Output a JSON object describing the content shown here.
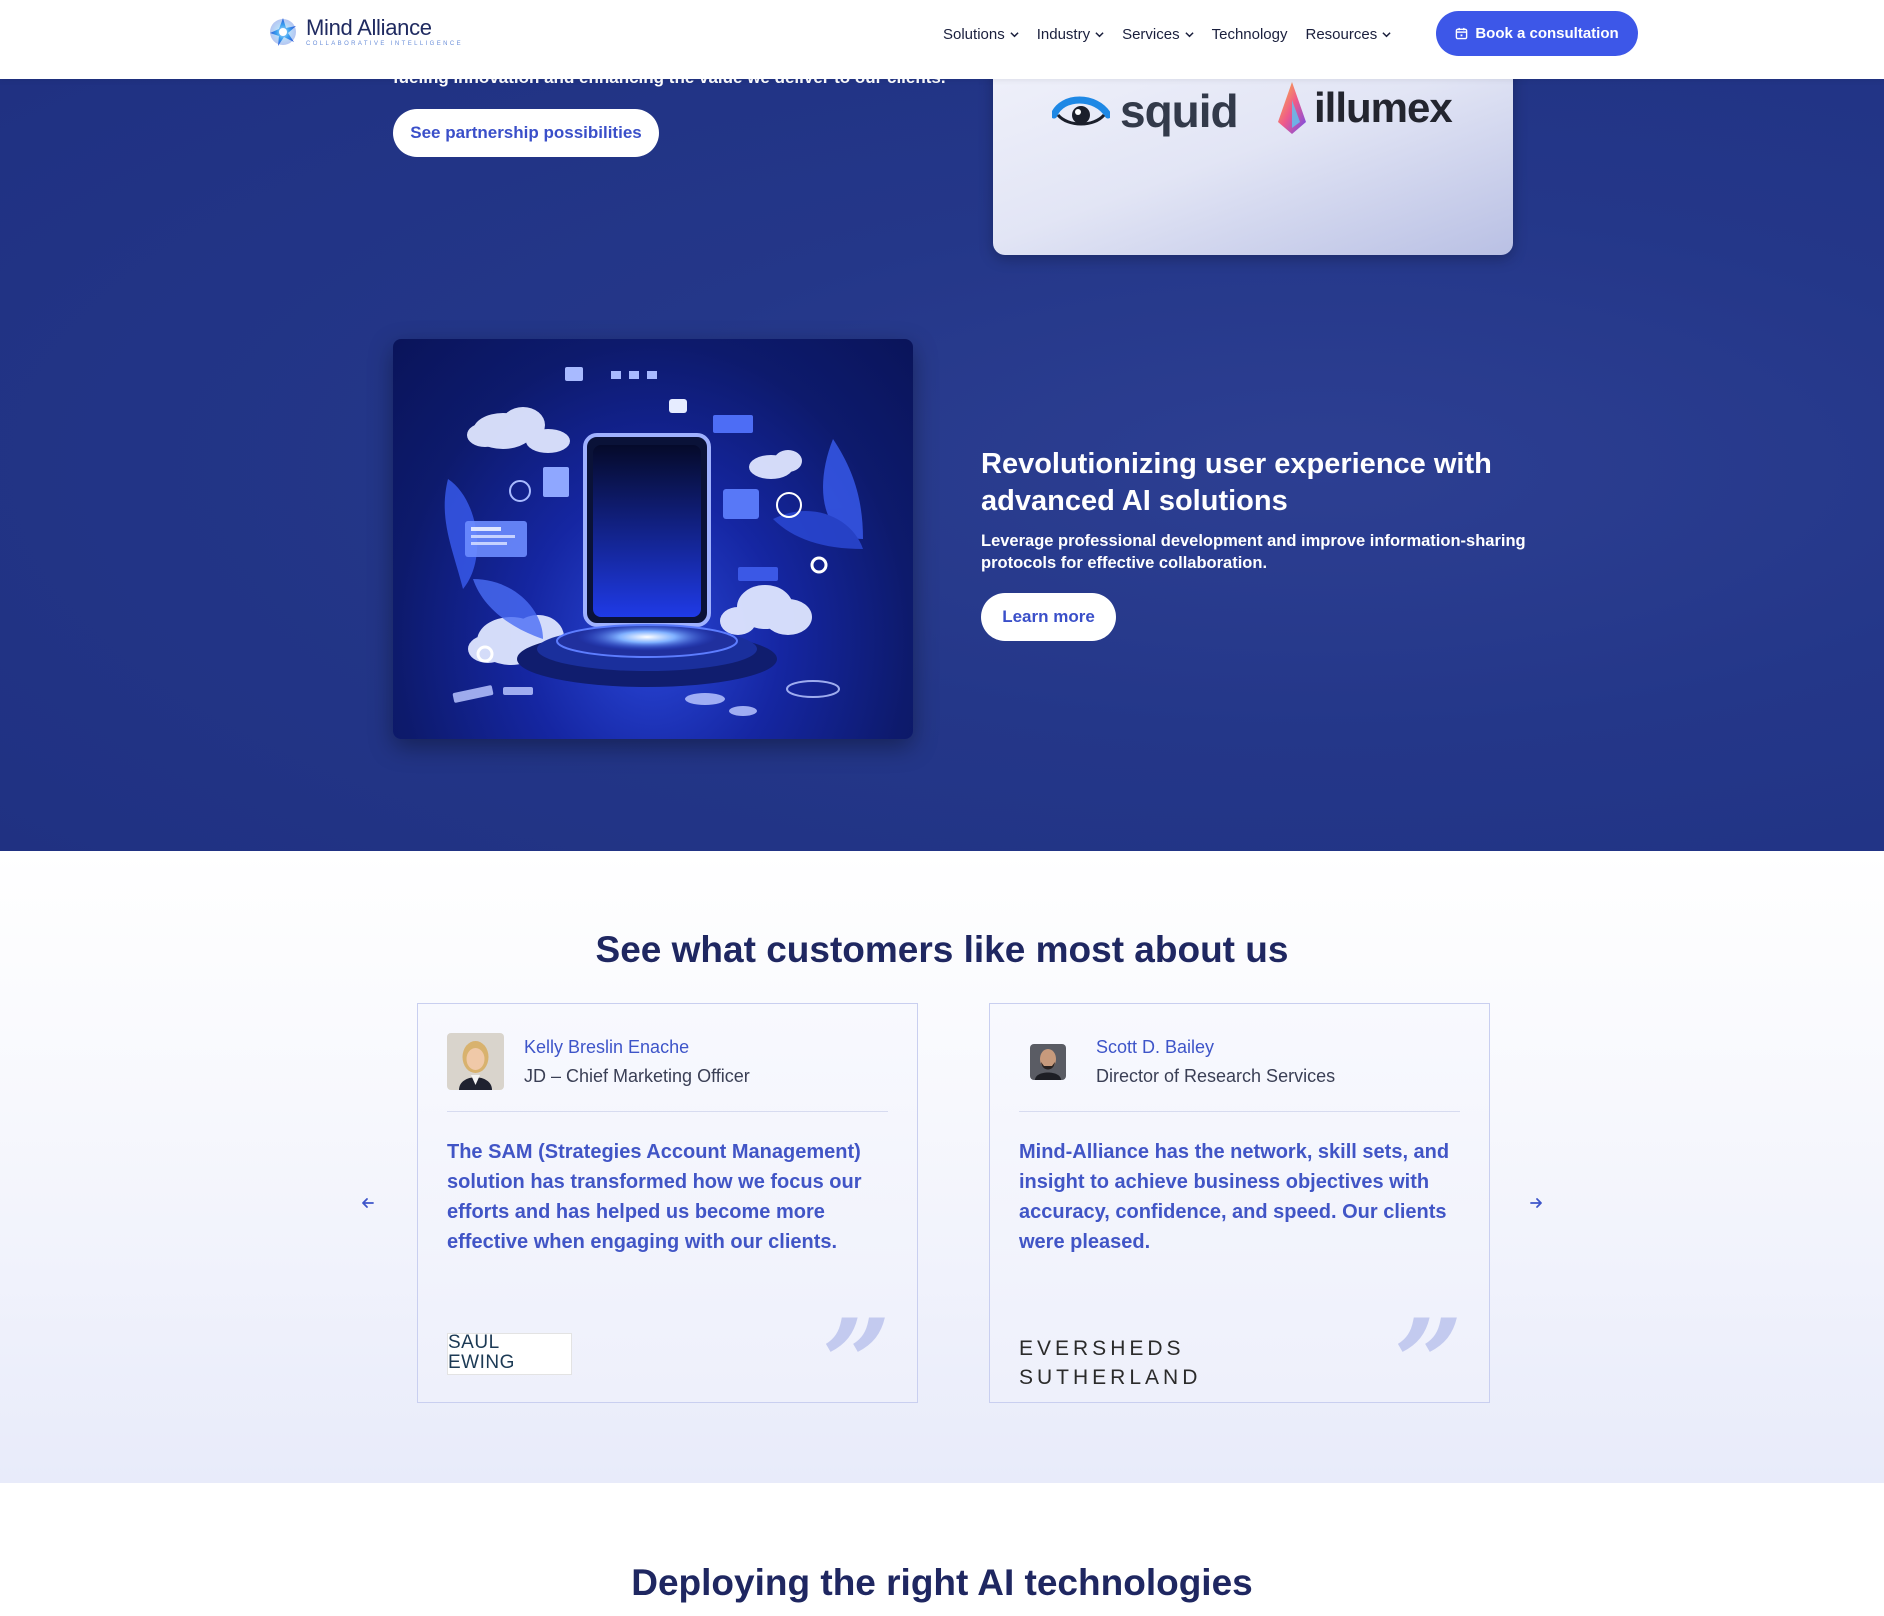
{
  "header": {
    "brand_name": "Mind Alliance",
    "brand_tagline": "COLLABORATIVE INTELLIGENCE",
    "nav": [
      {
        "label": "Solutions",
        "has_dropdown": true
      },
      {
        "label": "Industry",
        "has_dropdown": true
      },
      {
        "label": "Services",
        "has_dropdown": true
      },
      {
        "label": "Technology",
        "has_dropdown": false
      },
      {
        "label": "Resources",
        "has_dropdown": true
      }
    ],
    "cta_label": "Book a consultation",
    "cta_icon": "calendar-icon"
  },
  "partners": {
    "partial_text": "fueling innovation and enhancing the value we deliver to our clients.",
    "button_label": "See partnership possibilities",
    "logos": [
      "squid",
      "illumex"
    ]
  },
  "feature": {
    "heading": "Revolutionizing user experience with advanced AI solutions",
    "description": "Leverage professional development and improve information-sharing protocols for effective collaboration.",
    "button_label": "Learn more"
  },
  "testimonials": {
    "title": "See what customers like most about us",
    "items": [
      {
        "name": "Kelly Breslin Enache",
        "role": "JD – Chief Marketing Officer",
        "quote": "The SAM (Strategies Account Management) solution has transformed how we focus our efforts and has helped us become more effective when engaging with our clients.",
        "company_logo": "SAUL EWING"
      },
      {
        "name": "Scott D. Bailey",
        "role": "Director of Research Services",
        "quote": "Mind-Alliance has the network, skill sets, and insight to achieve business objectives with accuracy, confidence, and speed. Our clients were pleased.",
        "company_logo_line1": "EVERSHEDS",
        "company_logo_line2": "SUTHERLAND"
      }
    ],
    "prev_icon": "arrow-left-icon",
    "next_icon": "arrow-right-icon"
  },
  "next_section": {
    "title": "Deploying the right AI technologies"
  },
  "colors": {
    "primary": "#3d57e8",
    "navy": "#1f2761",
    "hero_bg": "#243789",
    "accent_text": "#4155c6"
  }
}
